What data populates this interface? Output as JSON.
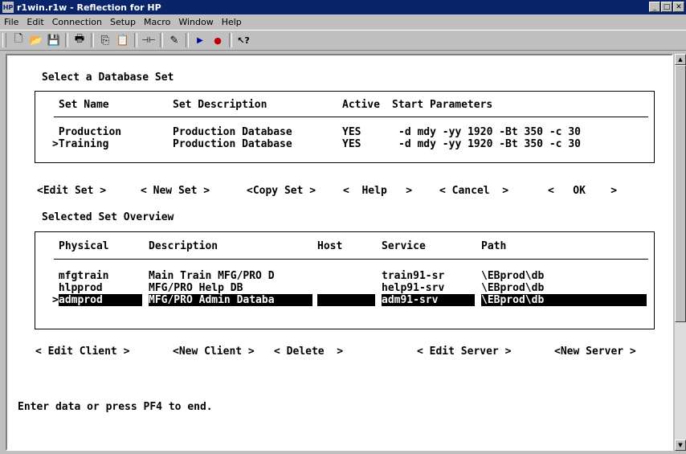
{
  "window": {
    "title": "r1win.r1w - Reflection for HP",
    "app_icon": "HP",
    "controls": {
      "minimize": "_",
      "maximize": "□",
      "close": "✕"
    }
  },
  "menu": [
    "File",
    "Edit",
    "Connection",
    "Setup",
    "Macro",
    "Window",
    "Help"
  ],
  "toolbar": {
    "buttons": [
      {
        "name": "new-icon",
        "glyph": "🗋"
      },
      {
        "name": "open-icon",
        "glyph": "📂"
      },
      {
        "name": "save-icon",
        "glyph": "💾"
      },
      {
        "name": "print-icon",
        "glyph": "🖶"
      },
      {
        "name": "copy-icon",
        "glyph": "⎘"
      },
      {
        "name": "paste-icon",
        "glyph": "📋"
      },
      {
        "name": "connect-icon",
        "glyph": "⊣⊢"
      },
      {
        "name": "clipboard-edit-icon",
        "glyph": "✎"
      },
      {
        "name": "play-macro-icon",
        "glyph": "▶"
      },
      {
        "name": "record-macro-icon",
        "glyph": "●"
      },
      {
        "name": "context-help-icon",
        "glyph": "↖?"
      }
    ]
  },
  "terminal": {
    "db_set_heading": "Select a Database Set",
    "db_set_columns": {
      "name": "Set Name",
      "description": "Set Description",
      "active": "Active",
      "params": "Start Parameters"
    },
    "db_sets": [
      {
        "marker": " ",
        "name": "Production",
        "description": "Production Database",
        "active": "YES",
        "params": "-d mdy -yy 1920 -Bt 350 -c 30"
      },
      {
        "marker": ">",
        "name": "Training",
        "description": "Production Database",
        "active": "YES",
        "params": "-d mdy -yy 1920 -Bt 350 -c 30"
      }
    ],
    "set_actions": [
      "<Edit Set >",
      "< New Set >",
      "<Copy Set >",
      "<  Help   >",
      "< Cancel  >",
      "<   OK    >"
    ],
    "overview_heading": "Selected Set Overview",
    "overview_columns": {
      "physical": "Physical",
      "description": "Description",
      "host": "Host",
      "service": "Service",
      "path": "Path"
    },
    "overview_rows": [
      {
        "marker": " ",
        "physical": "mfgtrain",
        "description": "Main Train MFG/PRO D",
        "host": "",
        "service": "train91-sr",
        "path": "\\EBprod\\db",
        "selected": false
      },
      {
        "marker": " ",
        "physical": "hlpprod",
        "description": "MFG/PRO Help DB",
        "host": "",
        "service": "help91-srv",
        "path": "\\EBprod\\db",
        "selected": false
      },
      {
        "marker": ">",
        "physical": "admprod",
        "description": "MFG/PRO Admin Databa",
        "host": "",
        "service": "adm91-srv",
        "path": "\\EBprod\\db",
        "selected": true
      }
    ],
    "client_actions": [
      "< Edit Client >",
      "<New Client >",
      "< Delete  >",
      "< Edit Server >",
      "<New Server >"
    ],
    "status_line": "Enter data or press PF4 to end."
  }
}
